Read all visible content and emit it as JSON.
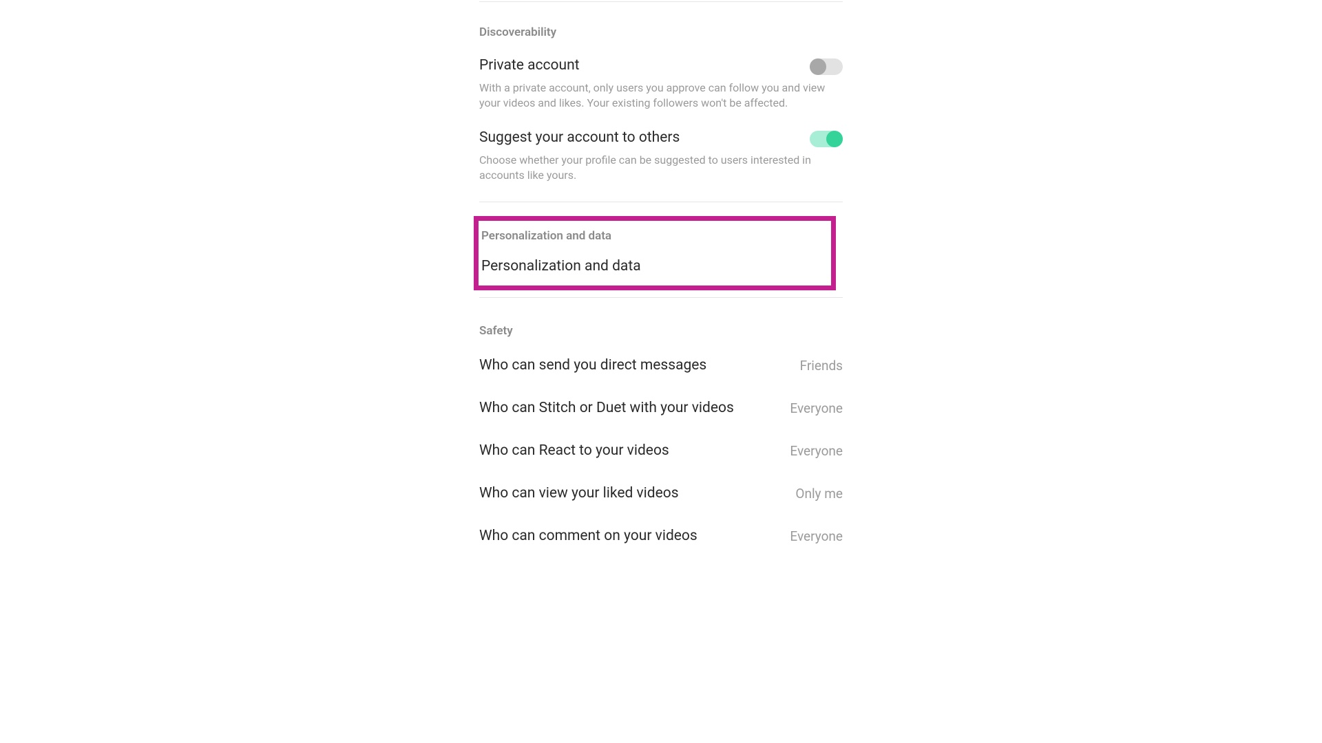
{
  "sections": {
    "discoverability": {
      "header": "Discoverability",
      "private_account": {
        "title": "Private account",
        "description": "With a private account, only users you approve can follow you and view your videos and likes. Your existing followers won't be affected.",
        "enabled": false
      },
      "suggest_account": {
        "title": "Suggest your account to others",
        "description": "Choose whether your profile can be suggested to users interested in accounts like yours.",
        "enabled": true
      }
    },
    "personalization": {
      "header": "Personalization and data",
      "item_title": "Personalization and data"
    },
    "safety": {
      "header": "Safety",
      "items": [
        {
          "label": "Who can send you direct messages",
          "value": "Friends"
        },
        {
          "label": "Who can Stitch or Duet with your videos",
          "value": "Everyone"
        },
        {
          "label": "Who can React to your videos",
          "value": "Everyone"
        },
        {
          "label": "Who can view your liked videos",
          "value": "Only me"
        },
        {
          "label": "Who can comment on your videos",
          "value": "Everyone"
        }
      ]
    }
  },
  "highlight_color": "#c41f8e"
}
